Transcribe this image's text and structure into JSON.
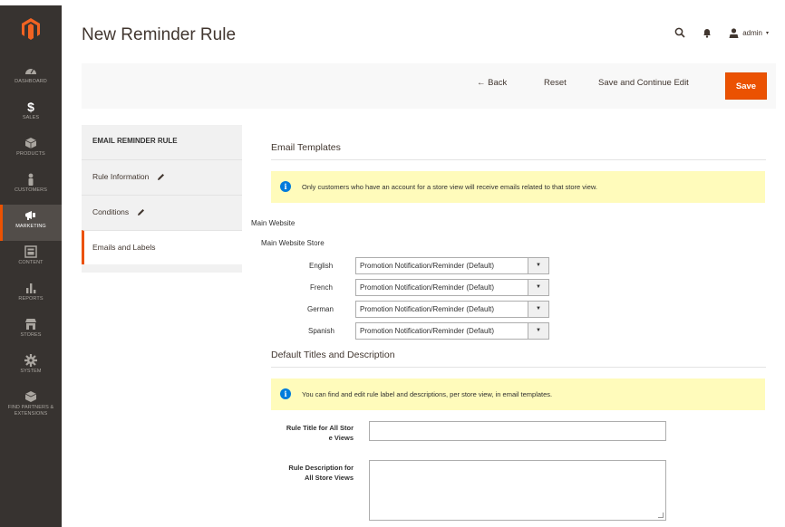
{
  "header": {
    "title": "New Reminder Rule",
    "admin_label": "admin"
  },
  "sidebar": {
    "items": [
      {
        "label": "Dashboard",
        "icon": "dashboard-icon"
      },
      {
        "label": "Sales",
        "icon": "dollar-icon"
      },
      {
        "label": "Products",
        "icon": "cube-icon"
      },
      {
        "label": "Customers",
        "icon": "person-icon"
      },
      {
        "label": "Marketing",
        "icon": "megaphone-icon",
        "active": true
      },
      {
        "label": "Content",
        "icon": "layout-icon"
      },
      {
        "label": "Reports",
        "icon": "bar-chart-icon"
      },
      {
        "label": "Stores",
        "icon": "storefront-icon"
      },
      {
        "label": "System",
        "icon": "gear-icon"
      },
      {
        "label": "Find Partners & Extensions",
        "icon": "box-icon"
      }
    ]
  },
  "actions": {
    "back": "← Back",
    "reset": "Reset",
    "save_continue": "Save and Continue Edit",
    "save": "Save"
  },
  "tabs": {
    "title": "EMAIL REMINDER RULE",
    "items": [
      {
        "label": "Rule Information"
      },
      {
        "label": "Conditions"
      },
      {
        "label": "Emails and Labels"
      }
    ]
  },
  "email_templates": {
    "title": "Email Templates",
    "notice": "Only customers who have an account for a store view will receive emails related to that store view.",
    "website": "Main Website",
    "store": "Main Website Store",
    "views": [
      {
        "label": "English",
        "value": "Promotion Notification/Reminder (Default)"
      },
      {
        "label": "French",
        "value": "Promotion Notification/Reminder (Default)"
      },
      {
        "label": "German",
        "value": "Promotion Notification/Reminder (Default)"
      },
      {
        "label": "Spanish",
        "value": "Promotion Notification/Reminder (Default)"
      }
    ]
  },
  "default_titles": {
    "title": "Default Titles and Description",
    "notice": "You can find and edit rule label and descriptions, per store view, in email templates.",
    "rule_title_label_1": "Rule Title for All Stor",
    "rule_title_label_2": "e Views",
    "rule_desc_label_1": "Rule Description for",
    "rule_desc_label_2": "All Store Views",
    "rule_title_value": "",
    "rule_desc_value": ""
  },
  "colors": {
    "accent": "#eb5202",
    "sidebar_bg": "#373330",
    "notice_bg": "#fffbbb",
    "info_blue": "#007bdb"
  }
}
